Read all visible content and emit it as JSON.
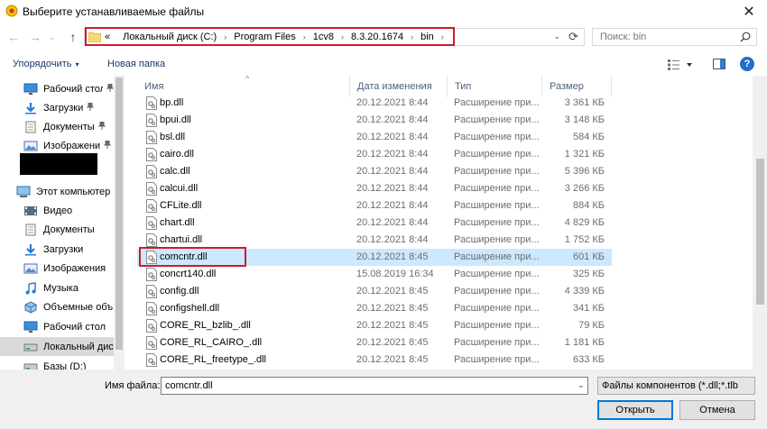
{
  "window": {
    "title": "Выберите устанавливаемые файлы",
    "close_glyph": "✕"
  },
  "nav": {
    "back_glyph": "←",
    "forward_glyph": "→",
    "recent_glyph": "⌄",
    "up_glyph": "↑"
  },
  "address": {
    "overflow": "«",
    "crumbs": [
      "Локальный диск (C:)",
      "Program Files",
      "1cv8",
      "8.3.20.1674",
      "bin"
    ],
    "separator": "›",
    "dropdown_glyph": "⌄",
    "refresh_glyph": "⟳"
  },
  "search": {
    "placeholder": "Поиск: bin"
  },
  "toolbar": {
    "organize_label": "Упорядочить",
    "organize_arrow": "▾",
    "new_folder_label": "Новая папка",
    "help_label": "?"
  },
  "navpane": {
    "items": [
      {
        "label": "Рабочий стол",
        "icon": "desktop-icon",
        "pinned": true
      },
      {
        "label": "Загрузки",
        "icon": "downloads-icon",
        "pinned": true
      },
      {
        "label": "Документы",
        "icon": "documents-icon",
        "pinned": true
      },
      {
        "label": "Изображени",
        "icon": "pictures-icon",
        "pinned": true
      },
      {
        "label": "Этот компьютер",
        "icon": "computer-icon",
        "pinned": false
      },
      {
        "label": "Видео",
        "icon": "video-icon",
        "pinned": false
      },
      {
        "label": "Документы",
        "icon": "documents-icon",
        "pinned": false
      },
      {
        "label": "Загрузки",
        "icon": "downloads-icon",
        "pinned": false
      },
      {
        "label": "Изображения",
        "icon": "pictures-icon",
        "pinned": false
      },
      {
        "label": "Музыка",
        "icon": "music-icon",
        "pinned": false
      },
      {
        "label": "Объемные объ",
        "icon": "3d-objects-icon",
        "pinned": false
      },
      {
        "label": "Рабочий стол",
        "icon": "desktop-icon",
        "pinned": false
      },
      {
        "label": "Локальный дис",
        "icon": "drive-icon",
        "pinned": false,
        "selected": true
      },
      {
        "label": "Базы (D:)",
        "icon": "drive-icon",
        "pinned": false
      }
    ],
    "pin_glyph": "📌"
  },
  "columns": {
    "name": "Имя",
    "date": "Дата изменения",
    "type": "Тип",
    "size": "Размер",
    "sort_glyph": "^"
  },
  "files": [
    {
      "name": "bp.dll",
      "date": "20.12.2021 8:44",
      "type": "Расширение при...",
      "size": "3 361 КБ"
    },
    {
      "name": "bpui.dll",
      "date": "20.12.2021 8:44",
      "type": "Расширение при...",
      "size": "3 148 КБ"
    },
    {
      "name": "bsl.dll",
      "date": "20.12.2021 8:44",
      "type": "Расширение при...",
      "size": "584 КБ"
    },
    {
      "name": "cairo.dll",
      "date": "20.12.2021 8:44",
      "type": "Расширение при...",
      "size": "1 321 КБ"
    },
    {
      "name": "calc.dll",
      "date": "20.12.2021 8:44",
      "type": "Расширение при...",
      "size": "5 396 КБ"
    },
    {
      "name": "calcui.dll",
      "date": "20.12.2021 8:44",
      "type": "Расширение при...",
      "size": "3 266 КБ"
    },
    {
      "name": "CFLite.dll",
      "date": "20.12.2021 8:44",
      "type": "Расширение при...",
      "size": "884 КБ"
    },
    {
      "name": "chart.dll",
      "date": "20.12.2021 8:44",
      "type": "Расширение при...",
      "size": "4 829 КБ"
    },
    {
      "name": "chartui.dll",
      "date": "20.12.2021 8:44",
      "type": "Расширение при...",
      "size": "1 752 КБ"
    },
    {
      "name": "comcntr.dll",
      "date": "20.12.2021 8:45",
      "type": "Расширение при...",
      "size": "601 КБ",
      "selected": true
    },
    {
      "name": "concrt140.dll",
      "date": "15.08.2019 16:34",
      "type": "Расширение при...",
      "size": "325 КБ"
    },
    {
      "name": "config.dll",
      "date": "20.12.2021 8:45",
      "type": "Расширение при...",
      "size": "4 339 КБ"
    },
    {
      "name": "configshell.dll",
      "date": "20.12.2021 8:45",
      "type": "Расширение при...",
      "size": "341 КБ"
    },
    {
      "name": "CORE_RL_bzlib_.dll",
      "date": "20.12.2021 8:45",
      "type": "Расширение при...",
      "size": "79 КБ"
    },
    {
      "name": "CORE_RL_CAIRO_.dll",
      "date": "20.12.2021 8:45",
      "type": "Расширение при...",
      "size": "1 181 КБ"
    },
    {
      "name": "CORE_RL_freetype_.dll",
      "date": "20.12.2021 8:45",
      "type": "Расширение при...",
      "size": "633 КБ"
    }
  ],
  "bottom": {
    "filename_label": "Имя файла:",
    "filename_value": "comcntr.dll",
    "filename_dd": "⌄",
    "filter_label": "Файлы компонентов (*.dll;*.tlb",
    "open_label": "Открыть",
    "cancel_label": "Отмена"
  },
  "colors": {
    "highlight": "#d01c25",
    "selection": "#cce8ff",
    "accent": "#0078d7"
  }
}
